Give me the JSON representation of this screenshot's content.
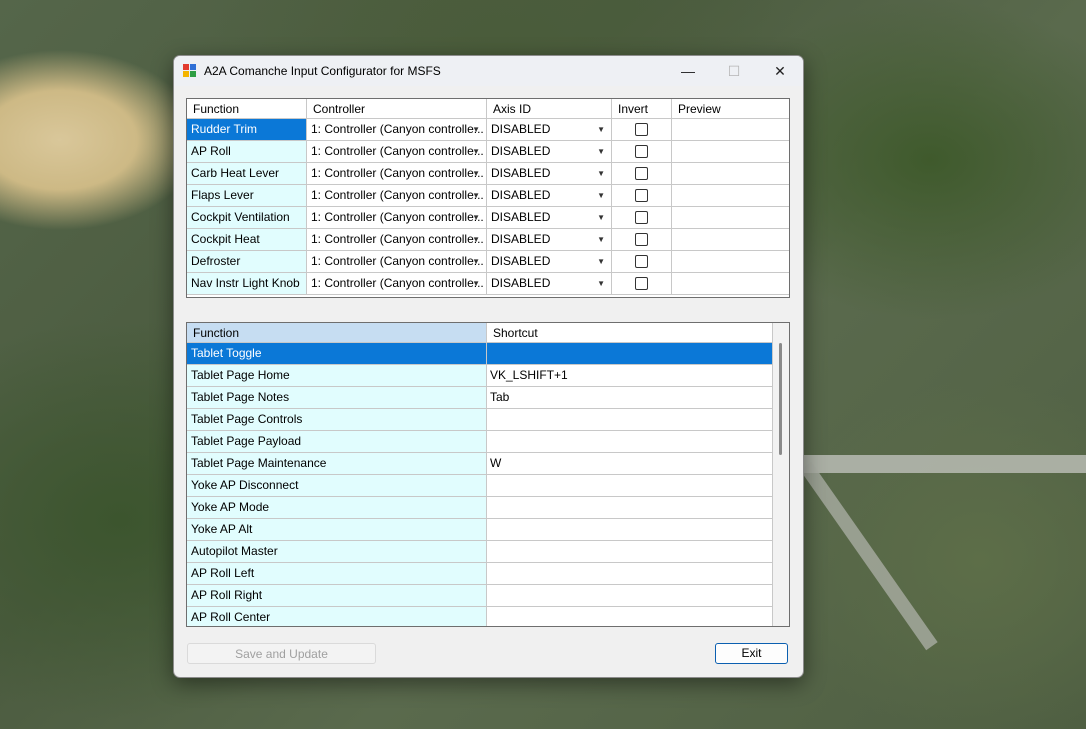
{
  "window": {
    "title": "A2A Comanche Input Configurator for MSFS",
    "minimize": "—",
    "maximize": "☐",
    "close": "✕"
  },
  "axes_grid": {
    "headers": [
      "Function",
      "Controller",
      "Axis ID",
      "Invert",
      "Preview"
    ],
    "rows": [
      {
        "function": "Rudder Trim",
        "controller": "1: Controller (Canyon controlle...",
        "axis": "DISABLED",
        "invert": false,
        "selected": true
      },
      {
        "function": "AP Roll",
        "controller": "1: Controller (Canyon controlle...",
        "axis": "DISABLED",
        "invert": false
      },
      {
        "function": "Carb Heat Lever",
        "controller": "1: Controller (Canyon controlle...",
        "axis": "DISABLED",
        "invert": false
      },
      {
        "function": "Flaps Lever",
        "controller": "1: Controller (Canyon controlle...",
        "axis": "DISABLED",
        "invert": false
      },
      {
        "function": "Cockpit Ventilation",
        "controller": "1: Controller (Canyon controlle...",
        "axis": "DISABLED",
        "invert": false
      },
      {
        "function": "Cockpit Heat",
        "controller": "1: Controller (Canyon controlle...",
        "axis": "DISABLED",
        "invert": false
      },
      {
        "function": "Defroster",
        "controller": "1: Controller (Canyon controlle...",
        "axis": "DISABLED",
        "invert": false
      },
      {
        "function": "Nav Instr Light Knob",
        "controller": "1: Controller (Canyon controlle...",
        "axis": "DISABLED",
        "invert": false
      }
    ]
  },
  "shortcuts_grid": {
    "headers": [
      "Function",
      "Shortcut"
    ],
    "rows": [
      {
        "function": "Tablet Toggle",
        "shortcut": "",
        "selected": true
      },
      {
        "function": "Tablet Page Home",
        "shortcut": "VK_LSHIFT+1"
      },
      {
        "function": "Tablet Page Notes",
        "shortcut": "Tab"
      },
      {
        "function": "Tablet Page Controls",
        "shortcut": ""
      },
      {
        "function": "Tablet Page Payload",
        "shortcut": ""
      },
      {
        "function": "Tablet Page Maintenance",
        "shortcut": "W"
      },
      {
        "function": "Yoke AP Disconnect",
        "shortcut": ""
      },
      {
        "function": "Yoke AP Mode",
        "shortcut": ""
      },
      {
        "function": "Yoke AP Alt",
        "shortcut": ""
      },
      {
        "function": "Autopilot Master",
        "shortcut": ""
      },
      {
        "function": "AP Roll Left",
        "shortcut": ""
      },
      {
        "function": "AP Roll Right",
        "shortcut": ""
      },
      {
        "function": "AP Roll Center",
        "shortcut": ""
      }
    ]
  },
  "buttons": {
    "save": "Save and Update",
    "exit": "Exit"
  },
  "colors": {
    "selection": "#0b78d7",
    "function_cell": "#e1fdfe",
    "header_highlight": "#c6ddf2",
    "exit_border": "#0b5fb0"
  }
}
